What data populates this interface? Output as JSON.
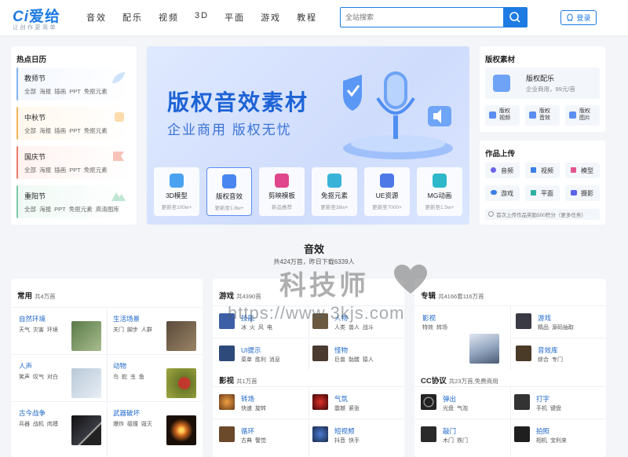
{
  "header": {
    "logo_mark": "Ci",
    "logo_text": "爱给",
    "logo_slogan": "让创作更简单",
    "nav": [
      "音效",
      "配乐",
      "视频",
      "3D",
      "平面",
      "游戏",
      "教程"
    ],
    "search_placeholder": "全站搜索",
    "login_label": "登录",
    "accent_color": "#1e7be3"
  },
  "hot_calendar": {
    "title": "热点日历",
    "items": [
      {
        "name": "教师节",
        "tags": "全部 海报 插画 PPT 免抠元素",
        "color": "#7fb3f2"
      },
      {
        "name": "中秋节",
        "tags": "全部 海报 插画 PPT 免抠元素",
        "color": "#f3b55b"
      },
      {
        "name": "国庆节",
        "tags": "全部 海报 插画 PPT 免抠元素",
        "color": "#ee7b6c"
      },
      {
        "name": "重阳节",
        "tags": "全部 海报 PPT 免抠元素 高清图库",
        "color": "#7dc9a6"
      }
    ]
  },
  "banner": {
    "headline": "版权音效素材",
    "subline": "企业商用 版权无忧",
    "tiles": [
      {
        "name": "3D模型",
        "update": "更新至100w+",
        "color": "#4aa3f0"
      },
      {
        "name": "版权音效",
        "update": "更新至1.8w+",
        "color": "#4a86f0"
      },
      {
        "name": "剪映模板",
        "update": "新品推荐",
        "color": "#e0468c"
      },
      {
        "name": "免抠元素",
        "update": "更新至38w+",
        "color": "#3ab3d9"
      },
      {
        "name": "UE资源",
        "update": "更新至7000+",
        "color": "#4d78e6"
      },
      {
        "name": "MG动画",
        "update": "更新至1.5w+",
        "color": "#2fb8c9"
      }
    ]
  },
  "copyright": {
    "title": "版权素材",
    "main_name": "版权配乐",
    "main_desc": "企业商用，99元/首",
    "buttons": [
      "版权视频",
      "版权音效",
      "版权图片"
    ]
  },
  "upload": {
    "title": "作品上传",
    "items": [
      {
        "label": "音频",
        "icon": "audio-icon",
        "color": "#6a63e8"
      },
      {
        "label": "视频",
        "icon": "video-icon",
        "color": "#3a7fe6"
      },
      {
        "label": "模型",
        "icon": "model-icon",
        "color": "#e3558f"
      },
      {
        "label": "游戏",
        "icon": "gamepad-icon",
        "color": "#3a7fe6"
      },
      {
        "label": "平面",
        "icon": "image-icon",
        "color": "#2fb0a0"
      },
      {
        "label": "摄影",
        "icon": "camera-icon",
        "color": "#5a63e8"
      }
    ],
    "notice": "首次上传作品奖励500积分（更多任务）"
  },
  "section": {
    "title": "音效",
    "subtitle": "共424万首，昨日下载6339人"
  },
  "common": {
    "title": "常用",
    "count": "共4万首",
    "items": [
      {
        "name": "自然环境",
        "tags": "天气 灾害 环境",
        "thumb": "#6f8a5a"
      },
      {
        "name": "生活场景",
        "tags": "关门 脚步 人群",
        "thumb": "#6b5a48"
      },
      {
        "name": "人声",
        "tags": "笑声 叹气 对白",
        "thumb": "#c9d6e2"
      },
      {
        "name": "动物",
        "tags": "鸟 蛇 虫 鱼",
        "thumb": "#7c8a3a"
      },
      {
        "name": "古今战争",
        "tags": "兵器 战机 肉搏",
        "thumb": "#2a2a30"
      },
      {
        "name": "武器破坏",
        "tags": "爆炸 碰撞 毁灭",
        "thumb": "#2b1a10"
      }
    ]
  },
  "games": {
    "title": "游戏",
    "count": "共4390首",
    "items": [
      {
        "name": "技能",
        "tags": "冰 火 风 电",
        "thumb": "#3d5fa6"
      },
      {
        "name": "人物",
        "tags": "人类 兽人 战斗",
        "thumb": "#6b5a40"
      },
      {
        "name": "UI提示",
        "tags": "菜单 胜利 消息",
        "thumb": "#2d4a7a"
      },
      {
        "name": "怪物",
        "tags": "巨兽 骷髅 猿人",
        "thumb": "#4a3a30"
      }
    ]
  },
  "film": {
    "title": "影视",
    "count": "共1万首",
    "items": [
      {
        "name": "转场",
        "tags": "快速 旋转",
        "thumb": "#6a3a1a"
      },
      {
        "name": "气氛",
        "tags": "震撼 紧张",
        "thumb": "#5a1010"
      },
      {
        "name": "循环",
        "tags": "古典 警觉",
        "thumb": "#6a4a2a"
      },
      {
        "name": "短视频",
        "tags": "抖音 快手",
        "thumb": "#1a2a4a"
      }
    ]
  },
  "albums": {
    "title": "专辑",
    "count": "共4166套116万首",
    "items": [
      {
        "name": "影视",
        "tags": "特效 转场",
        "thumb": "#b7c4d6"
      },
      {
        "name": "游戏",
        "tags": "精品 源码抽取",
        "thumb": "#3a3a44"
      },
      {
        "name": "音效库",
        "tags": "综合 专门",
        "thumb": "#4a3a28"
      }
    ]
  },
  "cc": {
    "title": "CC协议",
    "count": "共23万首,免费商用",
    "items": [
      {
        "name": "弹出",
        "tags": "光盘 气泡",
        "thumb": "#222"
      },
      {
        "name": "打字",
        "tags": "手机 键盘",
        "thumb": "#333"
      },
      {
        "name": "敲门",
        "tags": "木门 铁门",
        "thumb": "#2a2a2a"
      },
      {
        "name": "拍照",
        "tags": "相机 宝利来",
        "thumb": "#1f1f1f"
      }
    ]
  },
  "watermark": {
    "text": "科技师",
    "url": "https://www.3kjs.com"
  }
}
